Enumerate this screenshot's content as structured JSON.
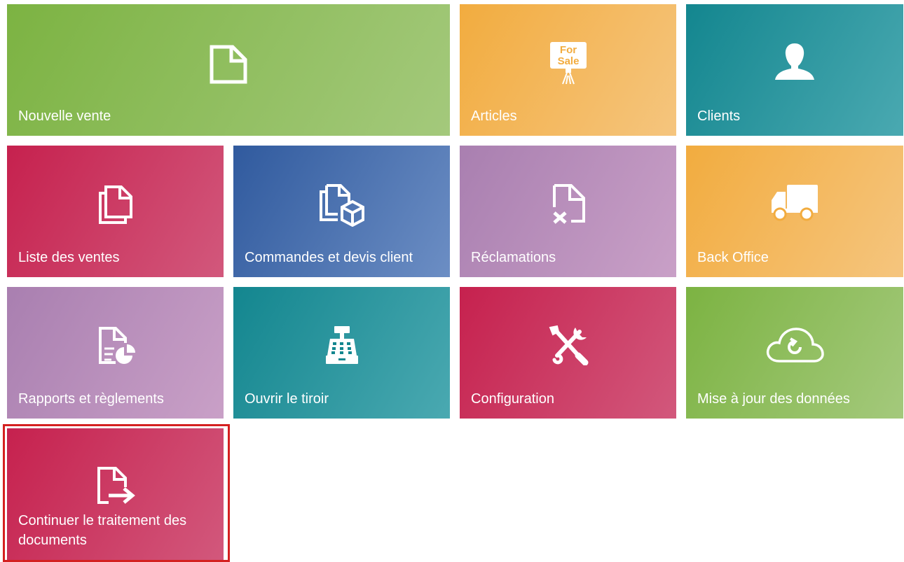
{
  "tiles": {
    "nouvelle_vente": {
      "label": "Nouvelle vente",
      "icon": "document-icon"
    },
    "articles": {
      "label": "Articles",
      "icon": "for-sale-sign-icon",
      "sign_line1": "For",
      "sign_line2": "Sale"
    },
    "clients": {
      "label": "Clients",
      "icon": "person-icon"
    },
    "liste_ventes": {
      "label": "Liste des ventes",
      "icon": "documents-stack-icon"
    },
    "commandes": {
      "label": "Commandes et devis client",
      "icon": "documents-box-icon"
    },
    "reclamations": {
      "label": "Réclamations",
      "icon": "document-cancel-icon"
    },
    "back_office": {
      "label": "Back Office",
      "icon": "truck-icon"
    },
    "rapports": {
      "label": "Rapports et règlements",
      "icon": "report-chart-icon"
    },
    "tiroir": {
      "label": "Ouvrir le tiroir",
      "icon": "cash-register-icon"
    },
    "configuration": {
      "label": "Configuration",
      "icon": "tools-icon"
    },
    "mise_a_jour": {
      "label": "Mise à jour des données",
      "icon": "cloud-sync-icon"
    },
    "continuer": {
      "label": "Continuer le traitement des documents",
      "icon": "document-forward-icon"
    }
  },
  "colors": {
    "green": "#7cb342",
    "orange": "#f2ac3f",
    "teal": "#13868f",
    "crimson": "#c6214e",
    "blue": "#305a9e",
    "mauve": "#a97fb0",
    "highlight": "#d42020"
  }
}
